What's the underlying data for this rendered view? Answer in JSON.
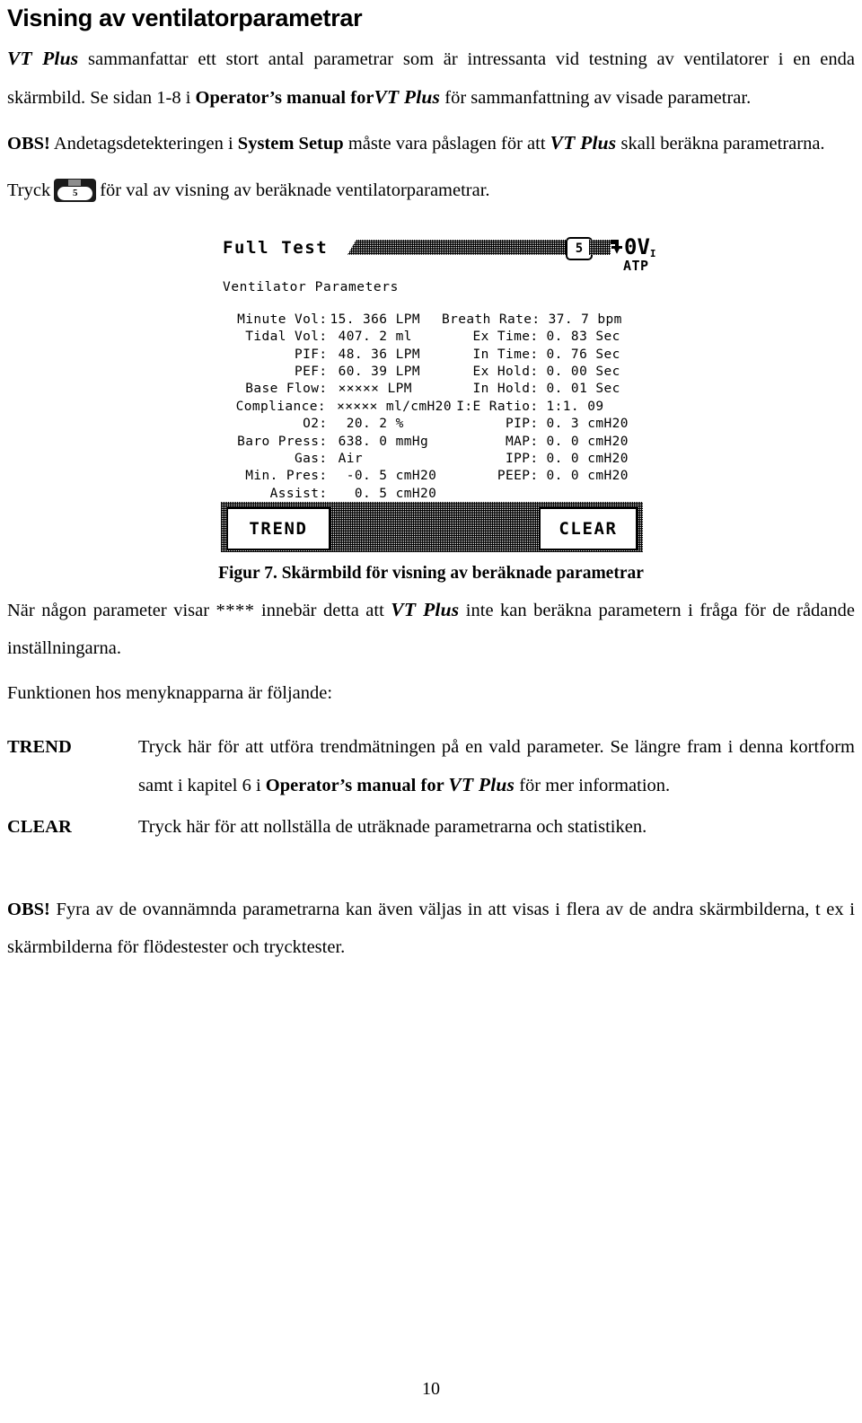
{
  "document": {
    "title": "Visning av ventilatorparametrar",
    "page_number": "10",
    "intro": {
      "p1_lead": "VT Plus",
      "p1_rest": " sammanfattar ett stort antal parametrar som är intressanta vid testning av ventilatorer i en enda skärmbild. Se sidan 1-8 i ",
      "p1_bold": "Operator’s manual for",
      "p1_vtplus": "VT Plus",
      "p1_tail": " för sammanfattning av visade parametrar."
    },
    "note_obs": {
      "prefix": "OBS!",
      "text_a": " Andetagsdetekteringen i ",
      "bold_a": "System Setup",
      "text_b": " måste vara påslagen för att ",
      "vtplus": "VT Plus",
      "text_c": " skall beräkna parametrarna."
    },
    "tryck_line": {
      "before": "Tryck",
      "key_label": "5",
      "key_sub": "▲▼",
      "after": "för val av visning av beräknade ventilatorparametrar."
    },
    "figure_caption": "Figur 7. Skärmbild för visning av beräknade parametrar",
    "after_figure": {
      "a": "När någon parameter visar ",
      "stars": "****",
      "b": " innebär detta att ",
      "vtplus": "VT Plus",
      "c": " inte kan beräkna parametern i fråga för de rådande inställningarna.",
      "menu_intro": "Funktionen hos menyknapparna är följande:"
    },
    "definitions": [
      {
        "term": "TREND",
        "desc_a": "Tryck här för att utföra trendmätningen på en vald parameter. Se längre fram i denna kortform samt i kapitel 6 i ",
        "desc_bold": "Operator’s manual for ",
        "desc_vtplus": "VT Plus",
        "desc_b": " för mer information."
      },
      {
        "term": "CLEAR",
        "desc_a": "Tryck här för att nollställa de uträknade parametrarna och statistiken.",
        "desc_bold": "",
        "desc_vtplus": "",
        "desc_b": ""
      }
    ],
    "note_obs2": {
      "prefix": "OBS!",
      "text": " Fyra av de ovannämnda parametrarna kan även väljas in att visas i flera av de andra skärmbilderna, t ex i skärmbilderna för flödestester och trycktester."
    }
  },
  "lcd": {
    "title": "Full Test",
    "badge": "5",
    "gas_standard": "ATP",
    "channel_number": "0",
    "channel_label": "V",
    "channel_sub": "I",
    "subtitle": "Ventilator Parameters",
    "rows": [
      {
        "l_label": "Minute Vol:",
        "l_value": "15. 366 LPM",
        "r_label": "Breath Rate:",
        "r_value": "37. 7 bpm"
      },
      {
        "l_label": "Tidal Vol:",
        "l_value": " 407. 2 ml",
        "r_label": "Ex Time:",
        "r_value": "0. 83 Sec"
      },
      {
        "l_label": "PIF:",
        "l_value": " 48. 36 LPM",
        "r_label": "In Time:",
        "r_value": "0. 76 Sec"
      },
      {
        "l_label": "PEF:",
        "l_value": " 60. 39 LPM",
        "r_label": "Ex Hold:",
        "r_value": "0. 00 Sec"
      },
      {
        "l_label": "Base Flow:",
        "l_value": " ××××× LPM",
        "r_label": "In Hold:",
        "r_value": "0. 01 Sec"
      },
      {
        "l_label": "Compliance:",
        "l_value": " ××××× ml/cmH20",
        "r_label": "I:E Ratio:",
        "r_value": "1:1. 09"
      },
      {
        "l_label": "O2:",
        "l_value": "  20. 2 %",
        "r_label": "PIP:",
        "r_value": "0. 3 cmH20"
      },
      {
        "l_label": "Baro Press:",
        "l_value": " 638. 0 mmHg",
        "r_label": "MAP:",
        "r_value": "0. 0 cmH20"
      },
      {
        "l_label": "Gas:",
        "l_value": " Air",
        "r_label": "IPP:",
        "r_value": "0. 0 cmH20"
      },
      {
        "l_label": "Min. Pres:",
        "l_value": "  -0. 5 cmH20",
        "r_label": "PEEP:",
        "r_value": "0. 0 cmH20"
      },
      {
        "l_label": "Assist:",
        "l_value": "   0. 5 cmH20",
        "r_label": "",
        "r_value": ""
      }
    ],
    "softkeys": {
      "left": "TREND",
      "right": "CLEAR"
    }
  }
}
